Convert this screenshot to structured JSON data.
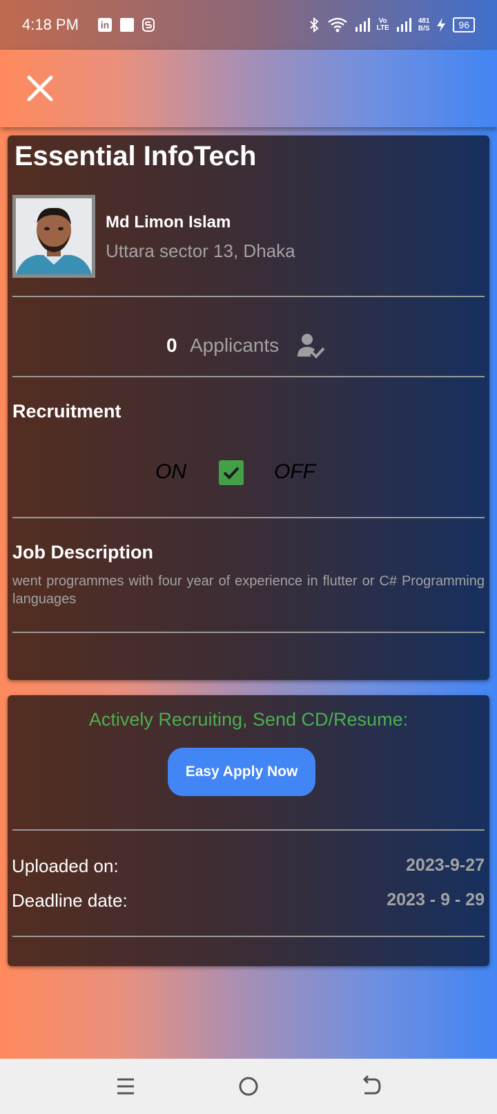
{
  "status_bar": {
    "time": "4:18 PM",
    "network_speed_value": "481",
    "network_speed_unit": "B/S",
    "battery": "96",
    "volte_top": "Vo",
    "volte_bottom": "LTE"
  },
  "company_name": "Essential InfoTech",
  "poster": {
    "name": "Md Limon Islam",
    "location": "Uttara sector 13, Dhaka"
  },
  "applicants": {
    "count": "0",
    "label": "Applicants"
  },
  "recruitment": {
    "title": "Recruitment",
    "on_label": "ON",
    "off_label": "OFF",
    "checked": true,
    "check_color": "#43a047"
  },
  "job_description": {
    "title": "Job Description",
    "text": "went programmes with four year of experience in flutter or C# Programming languages"
  },
  "apply": {
    "status_text": "Actively Recruiting, Send CD/Resume:",
    "button_label": "Easy Apply Now",
    "accent": "#4285f4",
    "status_color": "#4caf50"
  },
  "dates": {
    "uploaded_label": "Uploaded on:",
    "uploaded_value": "2023-9-27",
    "deadline_label": "Deadline date:",
    "deadline_value": "2023 - 9 - 29"
  },
  "icons": {
    "close": "close-icon",
    "applicants": "person-check-icon",
    "nav_menu": "menu-icon",
    "nav_home": "home-circle-icon",
    "nav_back": "back-icon"
  }
}
